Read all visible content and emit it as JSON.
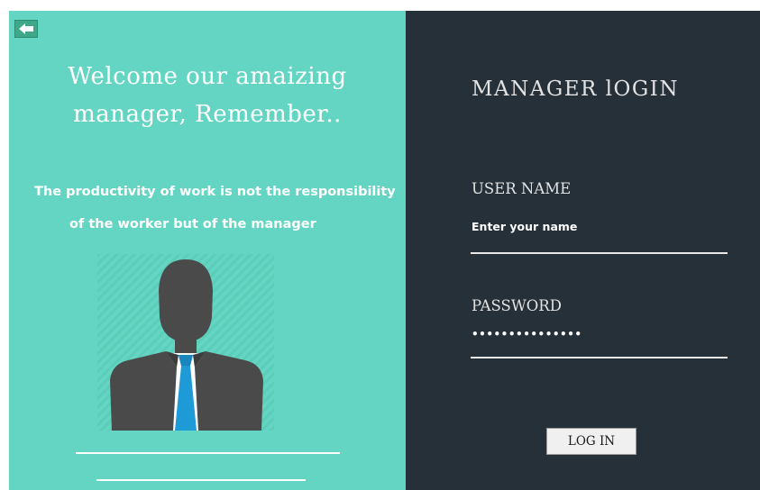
{
  "left_panel": {
    "back_icon": "back-arrow-icon",
    "welcome_line1": "Welcome our amaizing",
    "welcome_line2": "manager, Remember..",
    "quote_line1": "The productivity of work is not the responsibility",
    "quote_line2": "of the worker but of the manager",
    "avatar_icon": "manager-avatar-icon",
    "colors": {
      "background": "#63d5c2",
      "suit": "#4a4a4a",
      "tie": "#1e9ad6"
    }
  },
  "right_panel": {
    "title": "MANAGER lOGIN",
    "username": {
      "label": "USER NAME",
      "placeholder": "Enter your name",
      "value": ""
    },
    "password": {
      "label": "PASSWORD",
      "masked_value": "•••••••••••••••"
    },
    "login_button": "LOG IN",
    "colors": {
      "background": "#263039",
      "text": "#e3e3e3"
    }
  }
}
